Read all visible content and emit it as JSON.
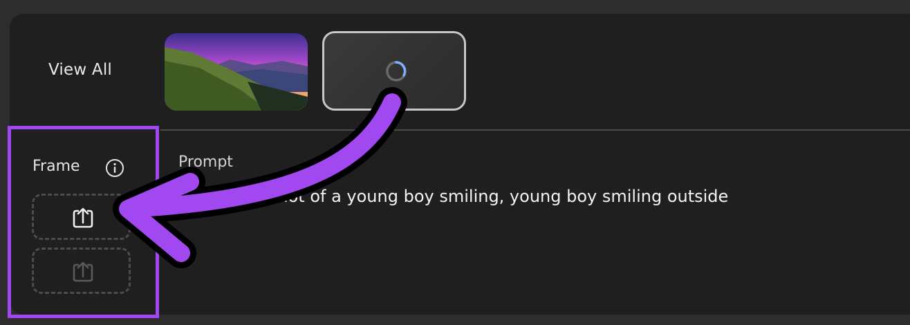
{
  "gallery": {
    "view_all_label": "View All",
    "thumbnail": "mountain-sunset-thumbnail",
    "loading_tile": "spinner-icon"
  },
  "frame": {
    "label": "Frame",
    "info_icon": "info-icon",
    "upload_slots": [
      "upload-icon",
      "upload-icon"
    ]
  },
  "prompt": {
    "label": "Prompt",
    "text": "a close-up shot of a young boy smiling, young boy smiling outside"
  },
  "annotation": {
    "highlight_color": "#a148f0"
  }
}
